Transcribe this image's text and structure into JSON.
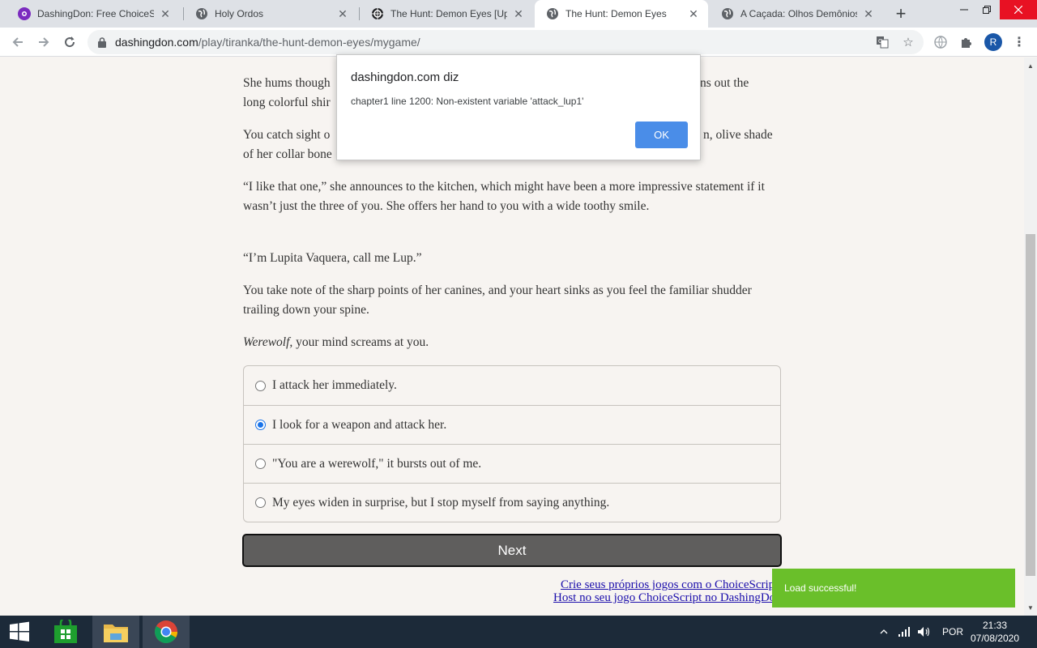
{
  "browser": {
    "tabs": [
      {
        "title": "DashingDon: Free ChoiceScri",
        "active": false,
        "favicon": "dashingdon-icon"
      },
      {
        "title": "Holy Ordos",
        "active": false,
        "favicon": "globe-icon"
      },
      {
        "title": "The Hunt: Demon Eyes [Upd",
        "active": false,
        "favicon": "hunt-icon"
      },
      {
        "title": "The Hunt: Demon Eyes",
        "active": true,
        "favicon": "globe-icon"
      },
      {
        "title": "A Caçada: Olhos Demônios",
        "active": false,
        "favicon": "globe-icon"
      }
    ],
    "address": {
      "host": "dashingdon.com",
      "path": "/play/tiranka/the-hunt-demon-eyes/mygame/"
    },
    "profile_initial": "R"
  },
  "story": {
    "paragraphs": [
      {
        "segments": [
          {
            "text": "She hums though"
          },
          {
            "text": "ns out the"
          }
        ]
      },
      {
        "text": "long colorful shir"
      },
      {
        "segments": [
          {
            "text": "You catch sight o"
          },
          {
            "text": "n, olive shade"
          }
        ]
      },
      {
        "text": "of her collar bone"
      },
      {
        "text": "“I like that one,” she announces to the kitchen, which might have been a more impressive statement if it wasn’t just the three of you. She offers her hand to you with a wide toothy smile."
      },
      {
        "text": "“I’m Lupita Vaquera, call me Lup.”"
      },
      {
        "text": "You take note of the sharp points of her canines, and your heart sinks as you feel the familiar shudder trailing down your spine."
      },
      {
        "italic": "Werewolf,",
        "text": " your mind screams at you."
      }
    ],
    "choices": [
      {
        "label": "I attack her immediately.",
        "selected": false
      },
      {
        "label": "I look for a weapon and attack her.",
        "selected": true
      },
      {
        "label": "\"You are a werewolf,\" it bursts out of me.",
        "selected": false
      },
      {
        "label": "My eyes widen in surprise, but I stop myself from saying anything.",
        "selected": false
      }
    ],
    "next_label": "Next",
    "footer_links": [
      "Crie seus próprios jogos com o ChoiceScript!",
      "Host no seu jogo ChoiceScript no DashingDon!"
    ]
  },
  "dialog": {
    "title": "dashingdon.com diz",
    "message": "chapter1 line 1200: Non-existent variable 'attack_lup1'",
    "ok_label": "OK"
  },
  "toast": {
    "text": "Load successful!",
    "color": "#6abf2a"
  },
  "taskbar": {
    "language": "POR",
    "time": "21:33",
    "date": "07/08/2020"
  },
  "colors": {
    "page_bg": "#f7f4f1",
    "next_button": "#5f5e5d",
    "dialog_ok": "#4a8de8",
    "taskbar": "#1c2a39"
  }
}
